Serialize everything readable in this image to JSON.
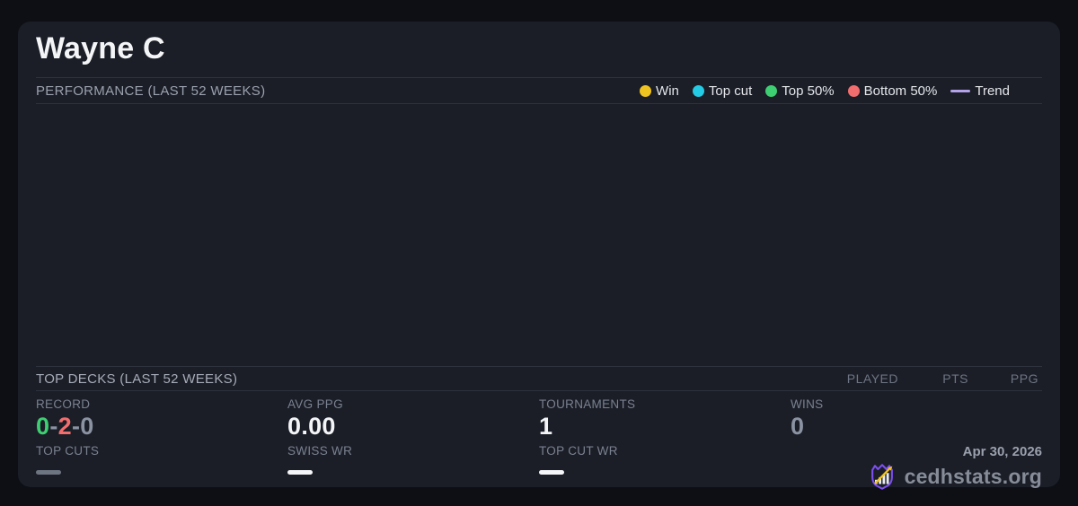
{
  "header": {
    "player_name": "Wayne C"
  },
  "performance": {
    "heading": "PERFORMANCE (LAST 52 WEEKS)",
    "legend": [
      {
        "label": "Win",
        "color": "#f0c420",
        "marker": "dot"
      },
      {
        "label": "Top cut",
        "color": "#24cbe5",
        "marker": "dot"
      },
      {
        "label": "Top 50%",
        "color": "#3ecf73",
        "marker": "dot"
      },
      {
        "label": "Bottom 50%",
        "color": "#f26d6d",
        "marker": "dot"
      },
      {
        "label": "Trend",
        "color": "#b3a2e9",
        "marker": "line"
      }
    ]
  },
  "chart_data": {
    "type": "scatter",
    "title": "PERFORMANCE (LAST 52 WEEKS)",
    "x": [],
    "series": [
      {
        "name": "Win",
        "points": []
      },
      {
        "name": "Top cut",
        "points": []
      },
      {
        "name": "Top 50%",
        "points": []
      },
      {
        "name": "Bottom 50%",
        "points": []
      },
      {
        "name": "Trend",
        "points": []
      }
    ],
    "legend_position": "top-right",
    "grid": false,
    "note": "Plot area is rendered empty - no data points, axes or gridlines are visible"
  },
  "top_decks": {
    "heading": "TOP DECKS (LAST 52 WEEKS)",
    "columns": [
      "PLAYED",
      "PTS",
      "PPG"
    ],
    "rows": []
  },
  "stats": {
    "record": {
      "label": "RECORD",
      "parts": [
        {
          "text": "0",
          "color": "#3ecf73"
        },
        {
          "text": "-",
          "color": "#8b93a3"
        },
        {
          "text": "2",
          "color": "#f26d6d"
        },
        {
          "text": "-",
          "color": "#8b93a3"
        },
        {
          "text": "0",
          "color": "#8b93a3"
        }
      ]
    },
    "avg_ppg": {
      "label": "AVG PPG",
      "value": "0.00",
      "color": "#f3f4f6"
    },
    "tournaments": {
      "label": "TOURNAMENTS",
      "value": "1",
      "color": "#f3f4f6"
    },
    "wins": {
      "label": "WINS",
      "value": "0",
      "color": "#8b93a3"
    },
    "top_cuts": {
      "label": "TOP CUTS",
      "dash_color": "#6e7582"
    },
    "swiss_wr": {
      "label": "SWISS WR",
      "dash_color": "#f5f6f8"
    },
    "top_cut_wr": {
      "label": "TOP CUT WR",
      "dash_color": "#f5f6f8"
    }
  },
  "footer": {
    "date": "Apr 30, 2026",
    "brand": "cedhstats.org",
    "logo_colors": {
      "shield": "#7d4ff0",
      "bars": "#e8eaee",
      "arrow": "#f2c41d"
    }
  }
}
